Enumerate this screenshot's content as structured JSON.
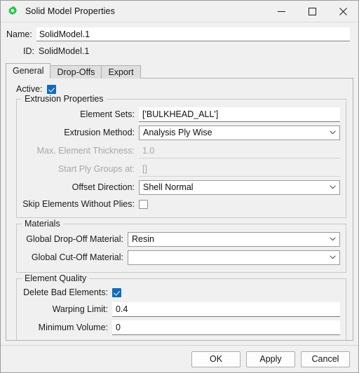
{
  "window": {
    "title": "Solid Model Properties",
    "icon": "gear-icon",
    "icon_color": "#21c63f",
    "minimize_label": "─",
    "maximize_label": "☐",
    "close_label": "✕"
  },
  "header": {
    "name_label": "Name:",
    "name_value": "SolidModel.1",
    "name_placeholder": "",
    "id_label": "ID:",
    "id_value": "SolidModel.1"
  },
  "tabs": [
    {
      "label": "General",
      "selected": true
    },
    {
      "label": "Drop-Offs",
      "selected": false
    },
    {
      "label": "Export",
      "selected": false
    }
  ],
  "general": {
    "active": {
      "label": "Active:",
      "checked": true
    },
    "extrusion": {
      "title": "Extrusion Properties",
      "element_sets": {
        "label": "Element Sets:",
        "value": "['BULKHEAD_ALL']",
        "disabled": false
      },
      "extrusion_method": {
        "label": "Extrusion Method:",
        "value": "Analysis Ply Wise",
        "disabled": false
      },
      "max_element_thickness": {
        "label": "Max. Element Thickness:",
        "value": "1.0",
        "disabled": true
      },
      "start_ply_groups_at": {
        "label": "Start Ply Groups at:",
        "value": "[]",
        "disabled": true
      },
      "offset_direction": {
        "label": "Offset Direction:",
        "value": "Shell Normal",
        "disabled": false
      },
      "skip_elements_without_plies": {
        "label": "Skip Elements Without Plies:",
        "checked": false
      }
    },
    "materials": {
      "title": "Materials",
      "global_drop_off_material": {
        "label": "Global Drop-Off Material:",
        "value": "Resin"
      },
      "global_cut_off_material": {
        "label": "Global Cut-Off Material:",
        "value": ""
      }
    },
    "element_quality": {
      "title": "Element Quality",
      "delete_bad_elements": {
        "label": "Delete Bad Elements:",
        "checked": true
      },
      "warping_limit": {
        "label": "Warping Limit:",
        "value": "0.4"
      },
      "minimum_volume": {
        "label": "Minimum Volume:",
        "value": "0"
      }
    }
  },
  "footer": {
    "ok_label": "OK",
    "apply_label": "Apply",
    "cancel_label": "Cancel"
  }
}
